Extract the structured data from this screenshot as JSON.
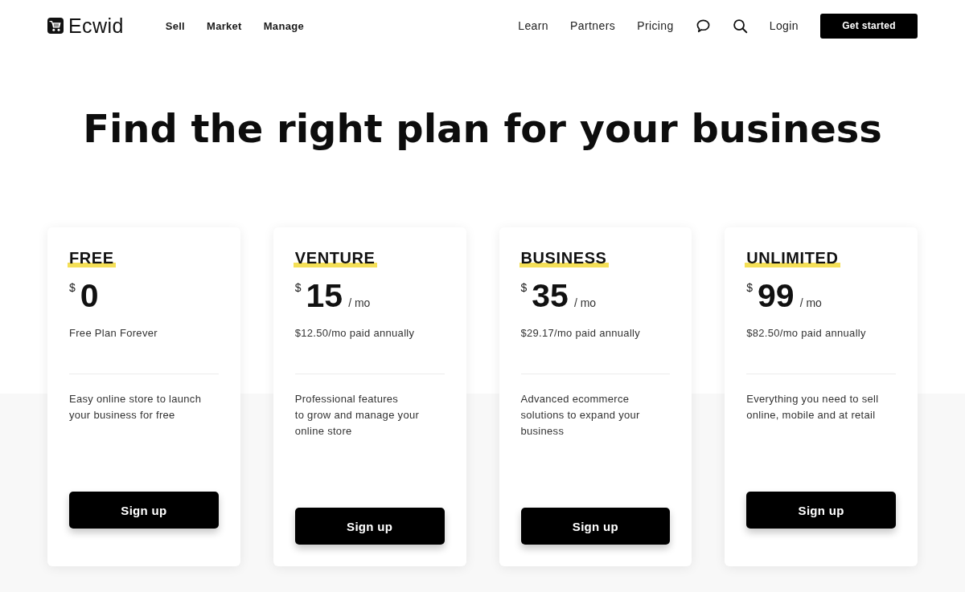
{
  "header": {
    "logo": "Ecwid",
    "main_nav": [
      "Sell",
      "Market",
      "Manage"
    ],
    "secondary_nav": [
      "Learn",
      "Partners",
      "Pricing"
    ],
    "login": "Login",
    "cta_button": "Get started"
  },
  "title": "Find the right plan for your business",
  "plans": [
    {
      "name": "FREE",
      "currency": "$",
      "price": "0",
      "billing": "Free Plan Forever",
      "description": "Easy online store to launch\nyour business for free",
      "button": "Sign up"
    },
    {
      "name": "VENTURE",
      "currency": "$",
      "price": "15",
      "period": "/ mo",
      "billing": "$12.50/mo paid annually",
      "description": "Professional features\nto grow and manage your\nonline store",
      "button": "Sign up"
    },
    {
      "name": "BUSINESS",
      "currency": "$",
      "price": "35",
      "period": "/ mo",
      "billing": "$29.17/mo paid annually",
      "description": "Advanced ecommerce\nsolutions to expand your\nbusiness",
      "button": "Sign up"
    },
    {
      "name": "UNLIMITED",
      "currency": "$",
      "price": "99",
      "period": "/ mo",
      "billing": "$82.50/mo paid annually",
      "description": "Everything you need to sell\nonline, mobile and at retail",
      "button": "Sign up"
    }
  ]
}
